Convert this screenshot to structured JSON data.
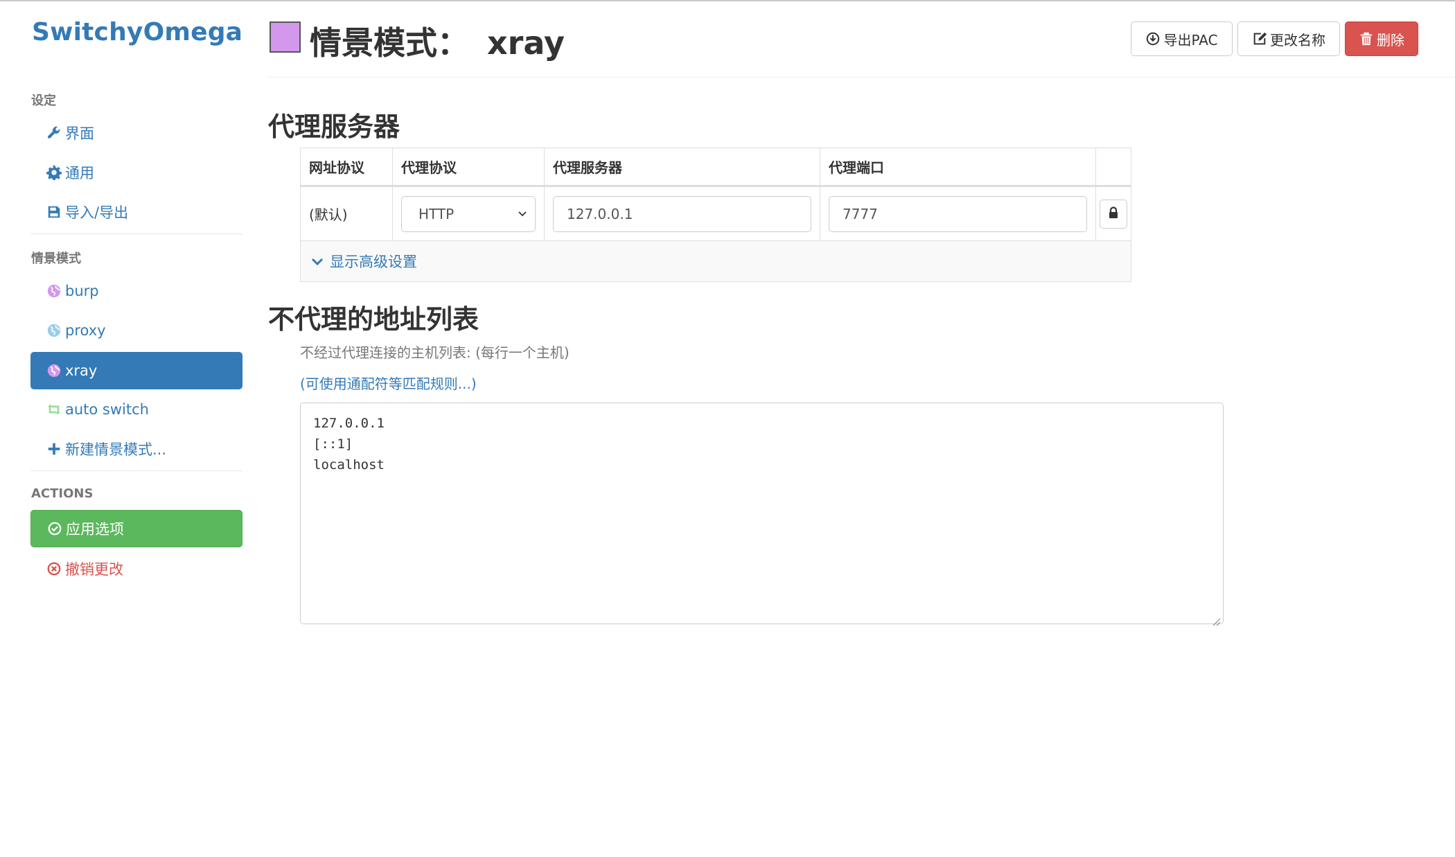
{
  "app": {
    "brand": "SwitchyOmega"
  },
  "sidebar": {
    "settings_header": "设定",
    "settings_items": [
      {
        "label": "界面",
        "icon": "wrench-icon"
      },
      {
        "label": "通用",
        "icon": "gear-icon"
      },
      {
        "label": "导入/导出",
        "icon": "floppy-disk-icon"
      }
    ],
    "profiles_header": "情景模式",
    "profiles": [
      {
        "label": "burp",
        "icon": "globe-icon",
        "color": "#d497ee"
      },
      {
        "label": "proxy",
        "icon": "globe-icon",
        "color": "#99ccee"
      },
      {
        "label": "xray",
        "icon": "globe-icon",
        "color": "#d497ee",
        "active": true
      },
      {
        "label": "auto switch",
        "icon": "retweet-icon",
        "color": "#99dd99"
      }
    ],
    "new_profile": "新建情景模式...",
    "actions_header": "ACTIONS",
    "apply_label": "应用选项",
    "discard_label": "撤销更改"
  },
  "header": {
    "title_prefix": "情景模式：",
    "profile_name": "xray",
    "profile_color": "#d497ee",
    "export_pac": "导出PAC",
    "rename": "更改名称",
    "delete": "删除"
  },
  "proxy_servers": {
    "section_title": "代理服务器",
    "columns": [
      "网址协议",
      "代理协议",
      "代理服务器",
      "代理端口"
    ],
    "rows": [
      {
        "scheme": "(默认)",
        "protocol": "HTTP",
        "server": "127.0.0.1",
        "port": "7777"
      }
    ],
    "advanced_toggle": "显示高级设置"
  },
  "bypass": {
    "section_title": "不代理的地址列表",
    "help_text": "不经过代理连接的主机列表: (每行一个主机)",
    "help_link": "(可使用通配符等匹配规则...)",
    "lines": [
      "127.0.0.1",
      "[::1]",
      "localhost"
    ]
  }
}
